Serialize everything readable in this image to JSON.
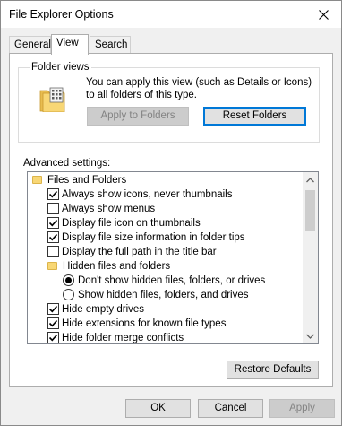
{
  "window": {
    "title": "File Explorer Options"
  },
  "tabs": [
    {
      "label": "General"
    },
    {
      "label": "View"
    },
    {
      "label": "Search"
    }
  ],
  "folder_views": {
    "group_label": "Folder views",
    "description": "You can apply this view (such as Details or Icons) to all folders of this type.",
    "apply_button": "Apply to Folders",
    "reset_button": "Reset Folders"
  },
  "advanced": {
    "label": "Advanced settings:",
    "items": [
      {
        "type": "folder",
        "label": "Files and Folders"
      },
      {
        "type": "checkbox",
        "label": "Always show icons, never thumbnails",
        "checked": true
      },
      {
        "type": "checkbox",
        "label": "Always show menus",
        "checked": false
      },
      {
        "type": "checkbox",
        "label": "Display file icon on thumbnails",
        "checked": true
      },
      {
        "type": "checkbox",
        "label": "Display file size information in folder tips",
        "checked": true
      },
      {
        "type": "checkbox",
        "label": "Display the full path in the title bar",
        "checked": false
      },
      {
        "type": "folder",
        "label": "Hidden files and folders"
      },
      {
        "type": "radio",
        "label": "Don't show hidden files, folders, or drives",
        "checked": true
      },
      {
        "type": "radio",
        "label": "Show hidden files, folders, and drives",
        "checked": false
      },
      {
        "type": "checkbox",
        "label": "Hide empty drives",
        "checked": true
      },
      {
        "type": "checkbox",
        "label": "Hide extensions for known file types",
        "checked": true
      },
      {
        "type": "checkbox",
        "label": "Hide folder merge conflicts",
        "checked": true
      }
    ],
    "restore_button": "Restore Defaults"
  },
  "footer": {
    "ok": "OK",
    "cancel": "Cancel",
    "apply": "Apply"
  },
  "icons": {
    "close": "close-icon",
    "folder": "folder-icon",
    "scroll_up": "chevron-up-icon",
    "scroll_down": "chevron-down-icon"
  }
}
